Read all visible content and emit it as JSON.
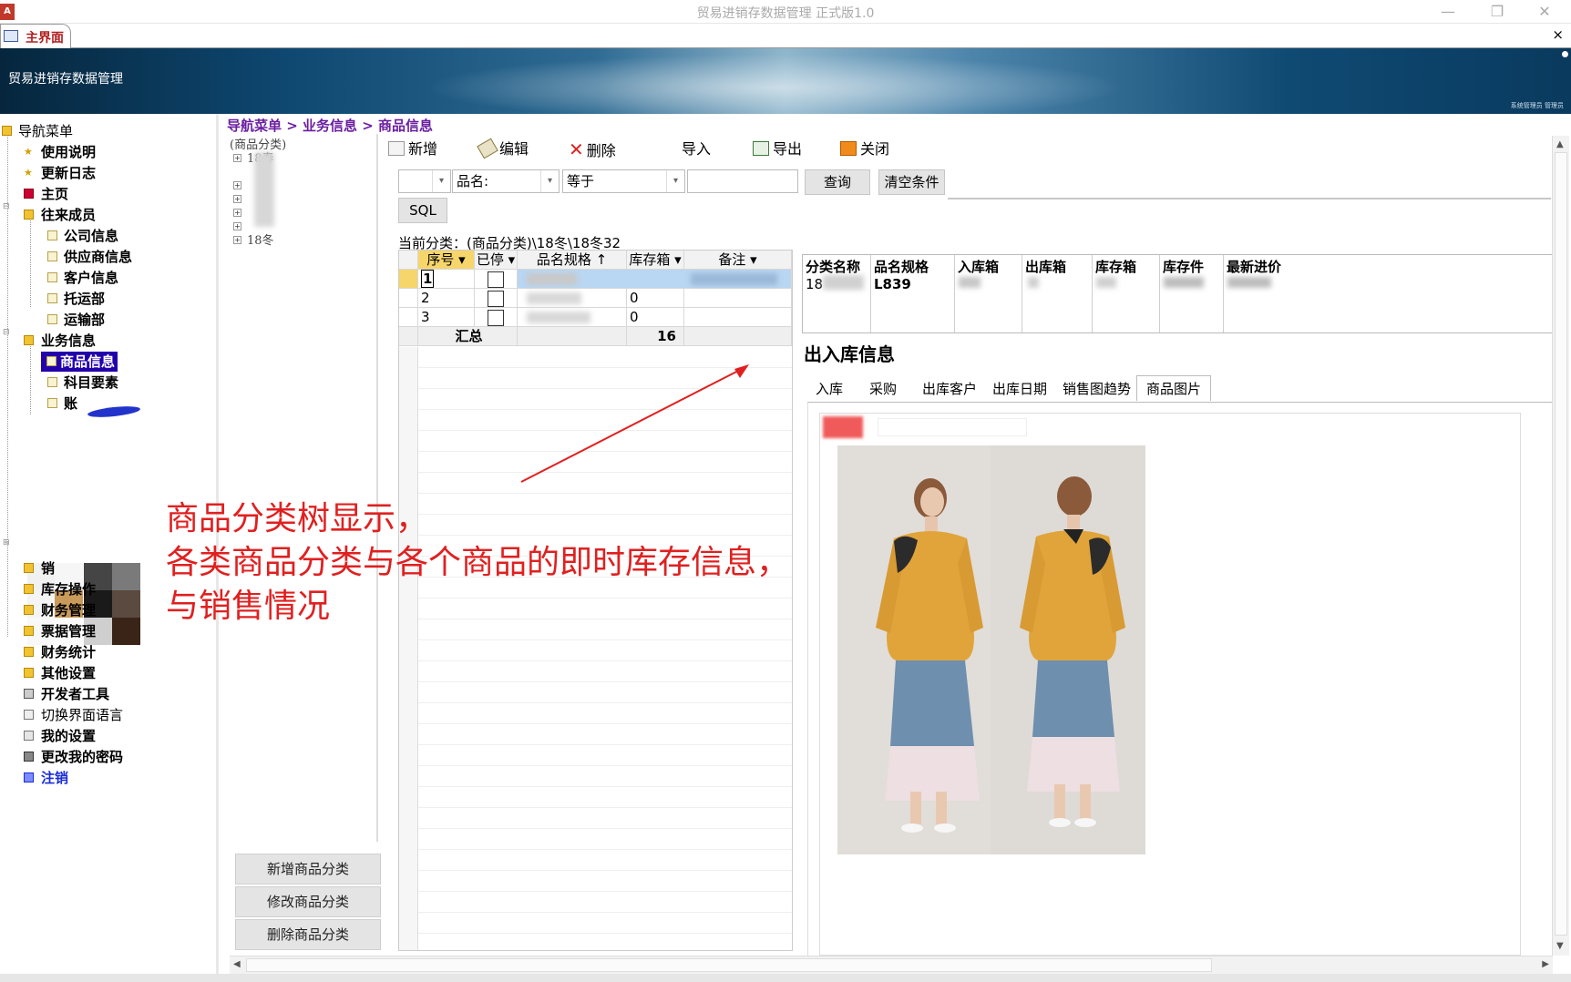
{
  "window": {
    "title": "贸易进销存数据管理 正式版1.0",
    "icon_text": "A",
    "minimize": "—",
    "restore": "❐",
    "close": "✕"
  },
  "tabs": {
    "main_tab": "主界面",
    "close": "×"
  },
  "banner": {
    "title": "贸易进销存数据管理",
    "user_info": "系统管理员 管理员"
  },
  "nav": {
    "root": "导航菜单",
    "items": [
      {
        "label": "使用说明"
      },
      {
        "label": "更新日志"
      },
      {
        "label": "主页"
      },
      {
        "label": "往来成员"
      },
      {
        "label": "公司信息"
      },
      {
        "label": "供应商信息"
      },
      {
        "label": "客户信息"
      },
      {
        "label": "托运部"
      },
      {
        "label": "运输部"
      },
      {
        "label": "业务信息"
      },
      {
        "label": "商品信息"
      },
      {
        "label": "科目要素"
      },
      {
        "label": "账"
      },
      {
        "label": "销"
      },
      {
        "label": "库存操作"
      },
      {
        "label": "财务管理"
      },
      {
        "label": "票据管理"
      },
      {
        "label": "财务统计"
      },
      {
        "label": "其他设置"
      },
      {
        "label": "开发者工具"
      },
      {
        "label": "切换界面语言"
      },
      {
        "label": "我的设置"
      },
      {
        "label": "更改我的密码"
      },
      {
        "label": "注销"
      }
    ]
  },
  "breadcrumb": "导航菜单 > 业务信息 > 商品信息",
  "category_tree": {
    "root": "(商品分类)",
    "nodes": [
      "18春",
      "18冬"
    ],
    "buttons": [
      "新增商品分类",
      "修改商品分类",
      "删除商品分类"
    ]
  },
  "toolbar": {
    "new": "新增",
    "edit": "编辑",
    "delete": "删除",
    "import": "导入",
    "export": "导出",
    "close": "关闭"
  },
  "filter": {
    "field_label": "品名:",
    "operator": "等于",
    "value": "",
    "query_button": "查询",
    "clear_button": "清空条件",
    "sql_button": "SQL"
  },
  "current_category": "当前分类：(商品分类)\\18冬\\18冬32",
  "grid": {
    "columns": [
      "序号",
      "已停",
      "品名规格",
      "库存箱",
      "备注"
    ],
    "rows": [
      {
        "no": "1",
        "stock": ""
      },
      {
        "no": "2",
        "stock": "0"
      },
      {
        "no": "3",
        "stock": "0"
      }
    ],
    "total_label": "汇总",
    "total_value": "16"
  },
  "detail": {
    "columns": [
      "分类名称",
      "品名规格",
      "入库箱",
      "出库箱",
      "库存箱",
      "库存件",
      "最新进价"
    ],
    "values": [
      "18",
      "L839",
      "",
      "",
      "",
      "",
      ""
    ]
  },
  "inout": {
    "title": "出入库信息",
    "tabs": [
      "入库",
      "采购",
      "出库客户",
      "出库日期",
      "销售图趋势",
      "商品图片"
    ]
  },
  "annotation": {
    "lines": [
      "商品分类树显示，",
      "各类商品分类与各个商品的即时库存信息，",
      "与销售情况"
    ]
  },
  "colors": {
    "accent": "#2200aa",
    "breadcrumb": "#6b1fa1",
    "annotation": "#e02020"
  }
}
